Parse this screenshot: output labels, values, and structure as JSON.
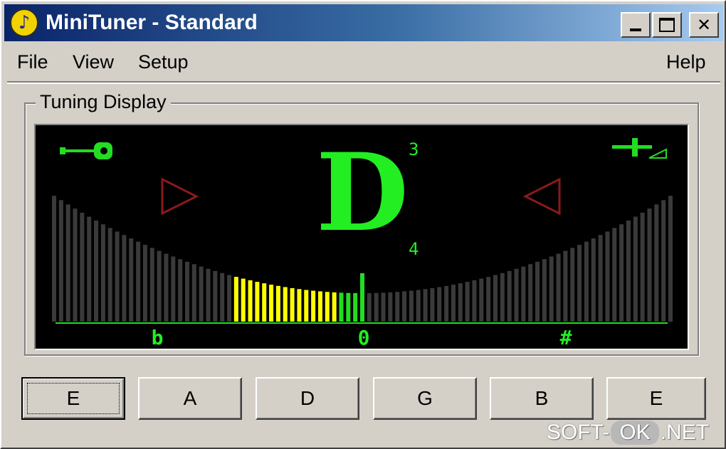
{
  "window": {
    "title": "MiniTuner - Standard"
  },
  "titlebar_buttons": {
    "minimize": "_",
    "maximize": "□",
    "close": "✕"
  },
  "menu": {
    "file": "File",
    "view": "View",
    "setup": "Setup",
    "help": "Help"
  },
  "tuning_display": {
    "label": "Tuning Display",
    "note": "D",
    "octave_upper": "3",
    "octave_lower": "4",
    "scale_labels": {
      "flat": "b",
      "zero": "0",
      "sharp": "#"
    },
    "bars": {
      "total": 89,
      "lit_from_index": 26,
      "lit_to_index": 44,
      "green_from_index": 41,
      "pointer_index": 44
    },
    "colors": {
      "display_bg": "#000000",
      "note": "#22ee22",
      "bar_unlit": "#3a3a3a",
      "bar_lit": "#ffff00",
      "bar_in_tune": "#22dd22",
      "arrow": "#8b1a1a"
    },
    "icons": [
      "guitar-icon",
      "flat-arrow-icon",
      "sharp-arrow-icon",
      "tuning-fork-icon"
    ]
  },
  "strings": [
    {
      "label": "E",
      "focused": true
    },
    {
      "label": "A",
      "focused": false
    },
    {
      "label": "D",
      "focused": false
    },
    {
      "label": "G",
      "focused": false
    },
    {
      "label": "B",
      "focused": false
    },
    {
      "label": "E",
      "focused": false
    }
  ],
  "watermark": {
    "left": "SOFT-",
    "mid": "OK",
    "right": ".NET"
  }
}
